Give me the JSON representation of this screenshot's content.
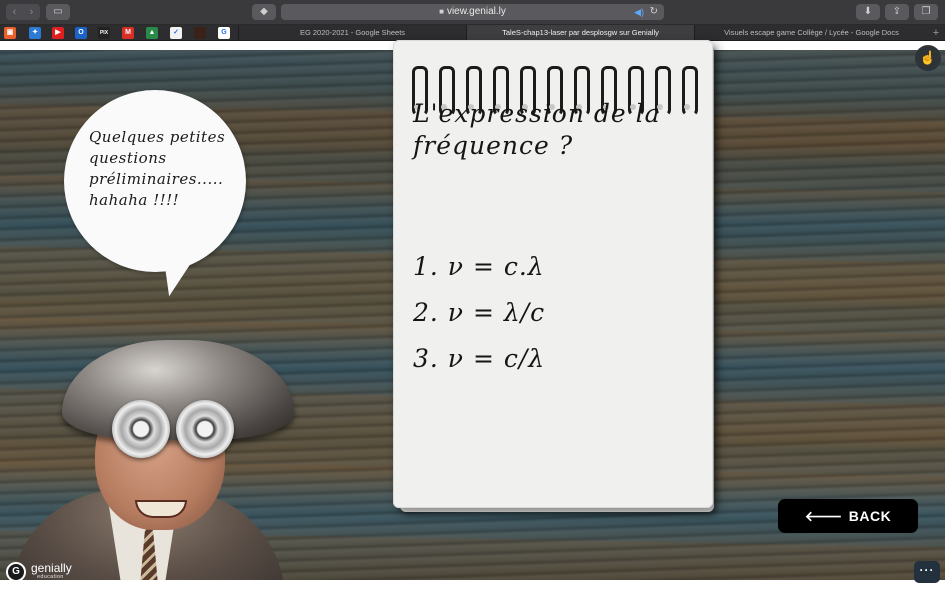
{
  "browser": {
    "address": "view.genial.ly",
    "bookmarks": [
      {
        "icon": "bookmark-generic-icon",
        "color": "#e8612c",
        "glyph": "▣"
      },
      {
        "icon": "bookmark-bird-icon",
        "color": "#2b7bd4",
        "glyph": "✦"
      },
      {
        "icon": "youtube-icon",
        "color": "#e02020",
        "glyph": "▶"
      },
      {
        "icon": "outlook-icon",
        "color": "#1b63c6",
        "glyph": "O"
      },
      {
        "icon": "pix-icon",
        "color": "#222222",
        "glyph": "PIX"
      },
      {
        "icon": "gmail-icon",
        "color": "#d93025",
        "glyph": "M"
      },
      {
        "icon": "google-drive-icon",
        "color": "#2a8a4a",
        "glyph": "▲"
      },
      {
        "icon": "nike-icon",
        "color": "#f2f2f2",
        "glyph": "✓"
      },
      {
        "icon": "dark-app-icon",
        "color": "#3a2218",
        "glyph": ""
      },
      {
        "icon": "google-icon",
        "color": "#ffffff",
        "glyph": "G"
      }
    ],
    "tabs": [
      {
        "label": "EG 2020-2021 - Google Sheets",
        "active": false
      },
      {
        "label": "TaleS-chap13-laser par desplosgw sur Genially",
        "active": true
      },
      {
        "label": "Visuels escape game Collège / Lycée - Google Docs",
        "active": false
      }
    ],
    "new_tab": "+"
  },
  "slide": {
    "bubble_text": "Quelques petites questions préliminaires..... hahaha !!!!",
    "note_title": "L'expression de la fréquence ?",
    "options": [
      "1. ν = c.λ",
      "2. ν = λ/c",
      "3. ν = c/λ"
    ],
    "back_label": "BACK"
  },
  "brand": {
    "logo": "G",
    "name": "genially",
    "sub": "education"
  }
}
